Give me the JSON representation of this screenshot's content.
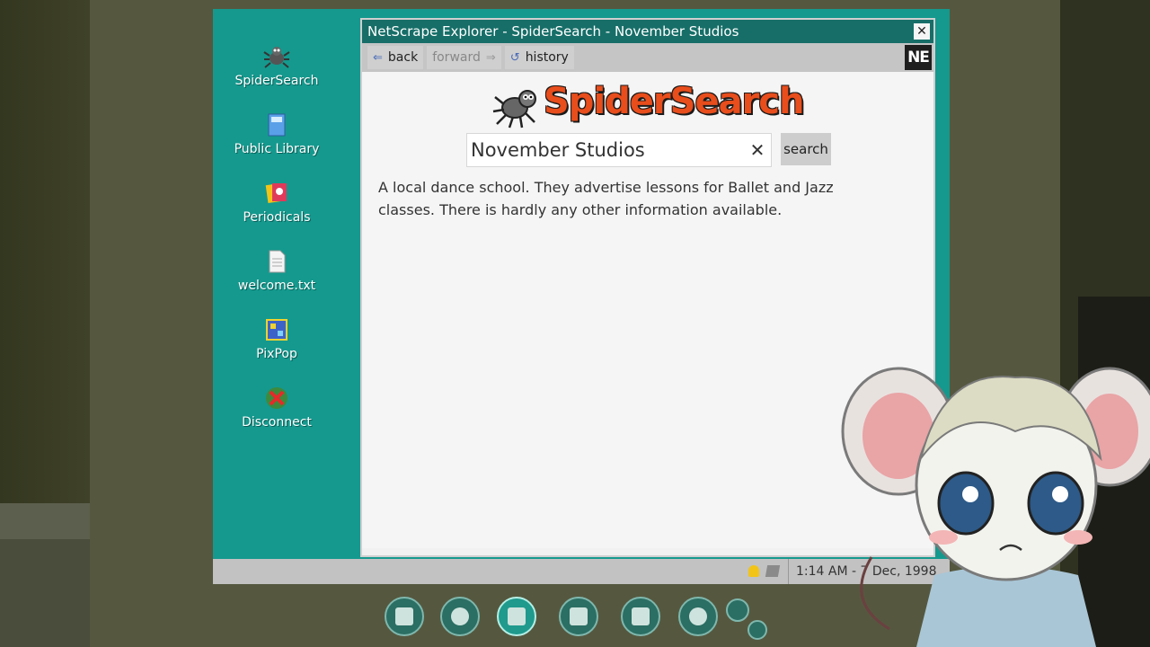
{
  "desktop": {
    "icons": [
      {
        "label": "SpiderSearch",
        "icon": "spider-icon"
      },
      {
        "label": "Public Library",
        "icon": "books-icon"
      },
      {
        "label": "Periodicals",
        "icon": "magazines-icon"
      },
      {
        "label": "welcome.txt",
        "icon": "text-file-icon"
      },
      {
        "label": "PixPop",
        "icon": "paint-icon"
      },
      {
        "label": "Disconnect",
        "icon": "disconnect-icon"
      }
    ]
  },
  "browser": {
    "title": "NetScrape Explorer - SpiderSearch - November Studios",
    "toolbar": {
      "back_label": "back",
      "forward_label": "forward",
      "history_label": "history",
      "logo_text": "NE"
    },
    "logo_text": "SpiderSearch",
    "search": {
      "value": "November Studios",
      "clear_glyph": "✕",
      "button_label": "search"
    },
    "result_text": "A local dance school. They advertise lessons for Ballet and Jazz classes. There is hardly any other information available."
  },
  "taskbar": {
    "clock": "1:14 AM - 7 Dec, 1998"
  },
  "colors": {
    "desktop": "#15998e",
    "titlebar": "#176e68",
    "logo": "#e84d1c"
  }
}
